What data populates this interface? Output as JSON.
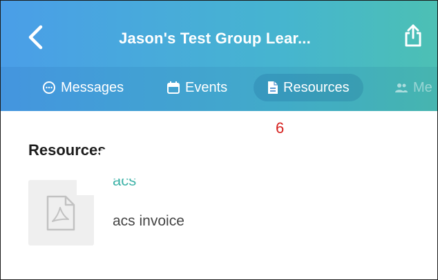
{
  "header": {
    "title": "Jason's Test Group Lear...",
    "back_icon": "chevron-left-icon",
    "share_icon": "share-icon"
  },
  "tabs": [
    {
      "label": "Messages",
      "icon": "chat-bubble-icon",
      "active": false
    },
    {
      "label": "Events",
      "icon": "calendar-icon",
      "active": false
    },
    {
      "label": "Resources",
      "icon": "document-icon",
      "active": true
    },
    {
      "label": "Me",
      "icon": "people-icon",
      "active": false
    }
  ],
  "overlay_marker": "6",
  "section": {
    "title": "Resources"
  },
  "resources": [
    {
      "name": "acs",
      "description": "acs invoice",
      "icon": "pdf-icon"
    }
  ],
  "colors": {
    "header_start": "#4a9ee8",
    "header_end": "#4cc0b4",
    "accent": "#3fb3a8",
    "marker": "#d6201e"
  }
}
